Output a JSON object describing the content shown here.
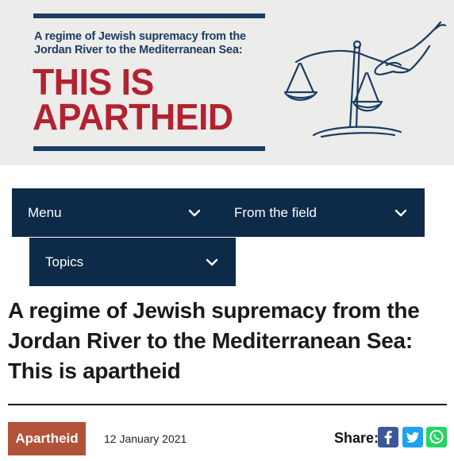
{
  "banner": {
    "subtitle_line1": "A regime of Jewish supremacy from the",
    "subtitle_line2": "Jordan River to the Mediterranean Sea:",
    "title_line1": "THIS IS",
    "title_line2": "APARTHEID",
    "image_icon": "justice-scales-illustration"
  },
  "nav": {
    "menu": {
      "label": "Menu",
      "icon": "chevron-down-icon"
    },
    "field": {
      "label": "From the field",
      "icon": "chevron-down-icon"
    },
    "topics": {
      "label": "Topics",
      "icon": "chevron-down-icon"
    }
  },
  "article": {
    "headline_line1": "A regime of Jewish supremacy from the",
    "headline_line2": "Jordan River to the Mediterranean Sea:",
    "headline_line3": "This is apartheid",
    "tag": "Apartheid",
    "date": "12 January 2021"
  },
  "share": {
    "label": "Share:",
    "buttons": [
      "facebook-icon",
      "twitter-icon",
      "whatsapp-icon"
    ]
  },
  "colors": {
    "navy": "#0d2a48",
    "banner_red": "#b22230",
    "banner_navy": "#1c3c62",
    "tag_bg": "#b25238",
    "facebook": "#3b5998",
    "twitter": "#1da1f2",
    "whatsapp": "#25d366"
  }
}
